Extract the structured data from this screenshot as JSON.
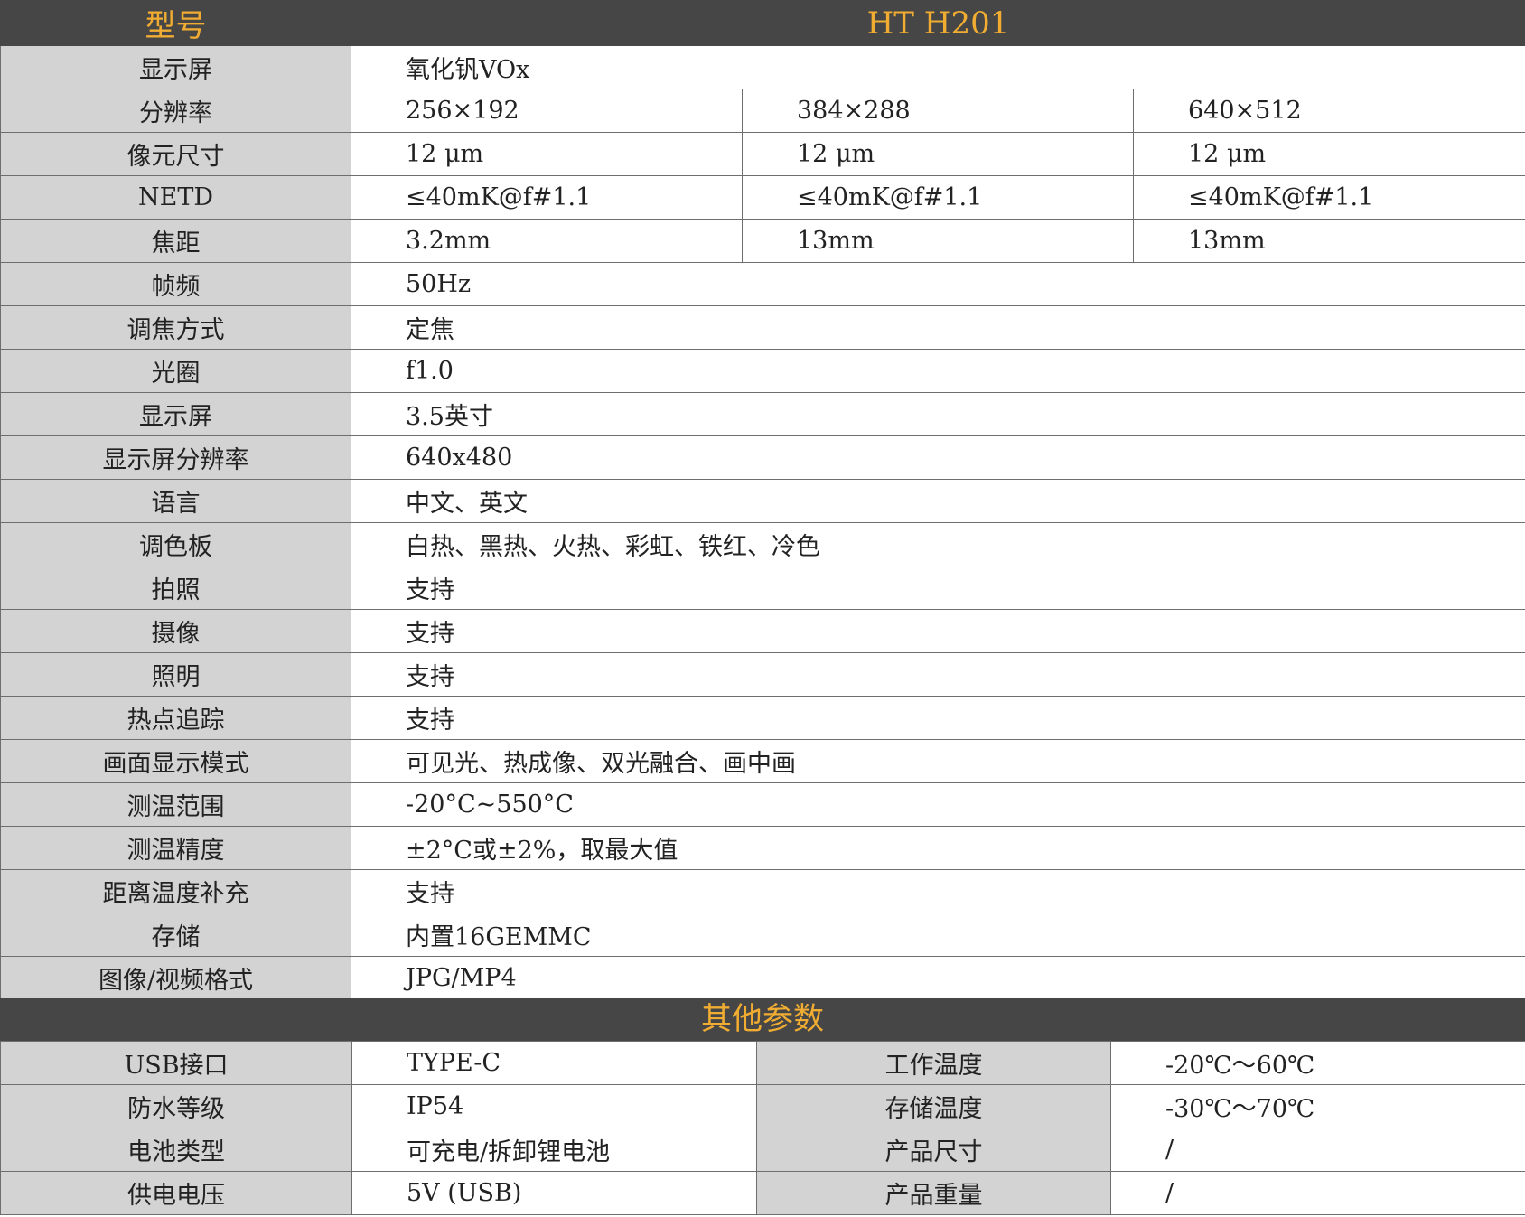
{
  "header": {
    "label": "型号",
    "model": "HT H201"
  },
  "specs": [
    {
      "label": "显示屏",
      "value": "氧化钒VOx"
    },
    {
      "label": "分辨率",
      "values": [
        "256×192",
        "384×288",
        "640×512"
      ]
    },
    {
      "label": "像元尺寸",
      "values": [
        "12 μm",
        "12 μm",
        "12 μm"
      ]
    },
    {
      "label": "NETD",
      "values": [
        "≤40mK@f#1.1",
        "≤40mK@f#1.1",
        "≤40mK@f#1.1"
      ]
    },
    {
      "label": "焦距",
      "values": [
        "3.2mm",
        "13mm",
        "13mm"
      ]
    },
    {
      "label": "帧频",
      "value": "50Hz"
    },
    {
      "label": "调焦方式",
      "value": "定焦"
    },
    {
      "label": "光圈",
      "value": "f1.0"
    },
    {
      "label": "显示屏",
      "value": "3.5英寸"
    },
    {
      "label": "显示屏分辨率",
      "value": "640x480"
    },
    {
      "label": "语言",
      "value": "中文、英文"
    },
    {
      "label": "调色板",
      "value": "白热、黑热、火热、彩虹、铁红、冷色"
    },
    {
      "label": "拍照",
      "value": "支持"
    },
    {
      "label": "摄像",
      "value": "支持"
    },
    {
      "label": "照明",
      "value": "支持"
    },
    {
      "label": "热点追踪",
      "value": "支持"
    },
    {
      "label": "画面显示模式",
      "value": "可见光、热成像、双光融合、画中画"
    },
    {
      "label": "测温范围",
      "value": "-20°C~550°C"
    },
    {
      "label": "测温精度",
      "value": "±2°C或±2%，取最大值"
    },
    {
      "label": "距离温度补充",
      "value": "支持"
    },
    {
      "label": "存储",
      "value": "内置16GEMMC"
    },
    {
      "label": "图像/视频格式",
      "value": "JPG/MP4"
    }
  ],
  "other": {
    "title": "其他参数",
    "rows": [
      {
        "label1": "USB接口",
        "value1": "TYPE-C",
        "label2": "工作温度",
        "value2": "-20℃～60℃"
      },
      {
        "label1": "防水等级",
        "value1": "IP54",
        "label2": "存储温度",
        "value2": "-30℃～70℃"
      },
      {
        "label1": "电池类型",
        "value1": "可充电/拆卸锂电池",
        "label2": "产品尺寸",
        "value2": "/"
      },
      {
        "label1": "供电电压",
        "value1": "5V (USB)",
        "label2": "产品重量",
        "value2": "/"
      }
    ]
  }
}
